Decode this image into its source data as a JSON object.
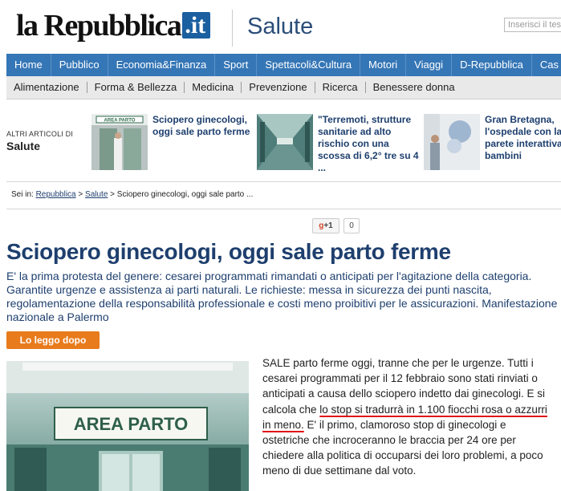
{
  "header": {
    "logo_text": "la Repubblica",
    "logo_suffix": ".it",
    "section": "Salute",
    "search_placeholder": "Inserisci il testo"
  },
  "main_nav": [
    "Home",
    "Pubblico",
    "Economia&Finanza",
    "Sport",
    "Spettacoli&Cultura",
    "Motori",
    "Viaggi",
    "D-Repubblica",
    "Cas"
  ],
  "sub_nav": [
    "Alimentazione",
    "Forma & Bellezza",
    "Medicina",
    "Prevenzione",
    "Ricerca",
    "Benessere donna"
  ],
  "related": {
    "label": "ALTRI ARTICOLI DI",
    "section": "Salute",
    "items": [
      {
        "title": "Sciopero ginecologi, oggi sale parto ferme",
        "thumb_text": "AREA PARTO"
      },
      {
        "title": "\"Terremoti, strutture sanitarie ad alto rischio con una scossa di 6,2° tre su 4 ..."
      },
      {
        "title": "Gran Bretagna, l'ospedale con la parete interattiva i bambini"
      }
    ]
  },
  "breadcrumb": {
    "prefix": "Sei in:",
    "links": [
      "Repubblica",
      "Salute"
    ],
    "current": "Sciopero ginecologi, oggi sale parto ..."
  },
  "social": {
    "gplus_label": "+1",
    "gplus_g": "g",
    "count": "0"
  },
  "article": {
    "headline": "Sciopero ginecologi, oggi sale parto ferme",
    "summary": "E' la prima protesta del genere: cesarei programmati rimandati o anticipati per l'agitazione della categoria. Garantite urgenze e assistenza ai parti naturali. Le richieste: messa in sicurezza dei punti nascita, regolamentazione della responsabilità professionale e costi meno proibitivi per le assicurazioni. Manifestazione nazionale a Palermo",
    "read_later": "Lo leggo dopo",
    "image_sign": "AREA PARTO",
    "body_1": "SALE parto ferme oggi, tranne che per le urgenze. Tutti i cesarei programmati per il 12 febbraio sono stati rinviati o anticipati a causa dello sciopero indetto dai ginecologi. E si calcola che ",
    "body_underlined": "lo stop si tradurrà in 1.100 fiocchi rosa o azzurri in meno.",
    "body_2": " E' il primo, clamoroso stop di ginecologi e ostetriche che incroceranno le braccia per 24 ore per chiedere alla politica di occuparsi dei loro problemi, a poco meno di due settimane dal voto."
  },
  "colors": {
    "nav_blue": "#3576b6",
    "headline_blue": "#1e3f6e",
    "button_orange": "#e87b1c",
    "underline_red": "#e01010"
  }
}
